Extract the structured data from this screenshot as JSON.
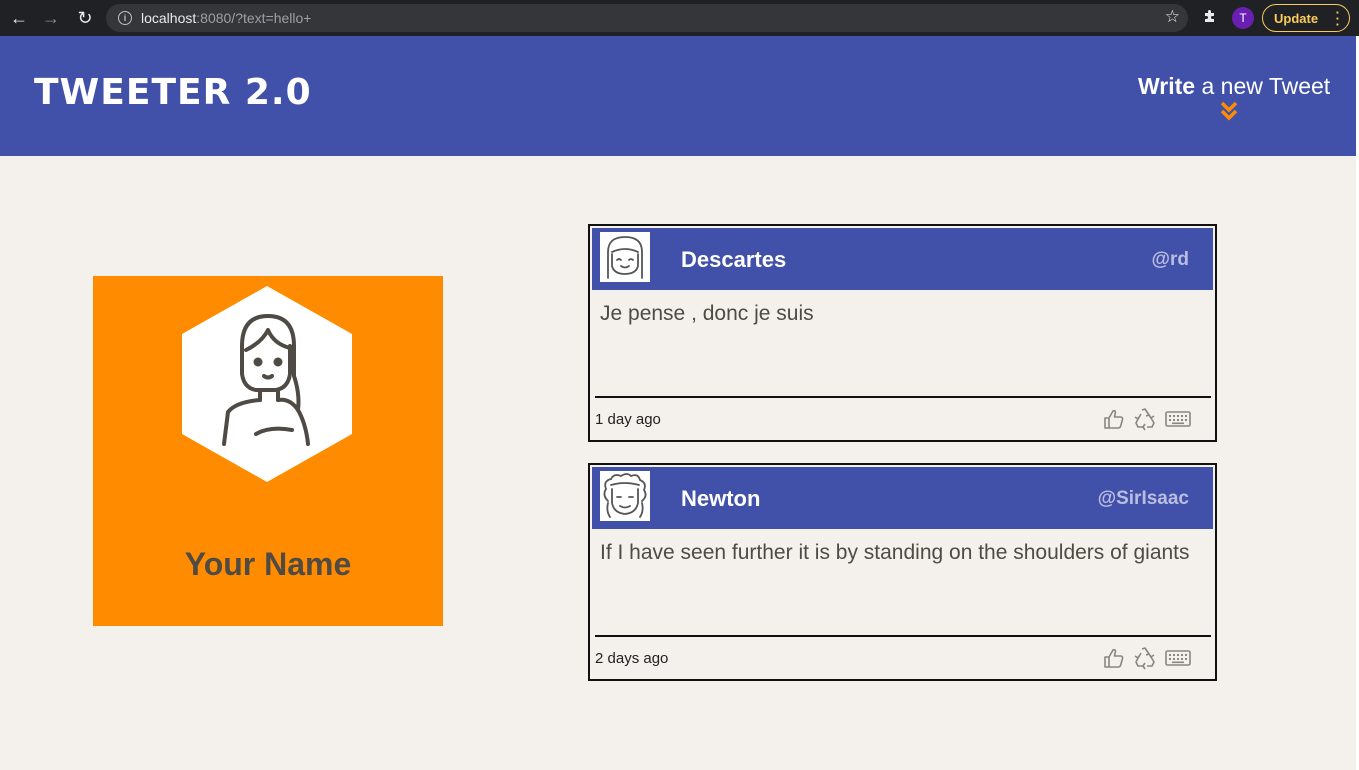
{
  "browser": {
    "url_host": "localhost",
    "url_rest": ":8080/?text=hello+",
    "profile_initial": "T",
    "update_label": "Update"
  },
  "header": {
    "brand": "TWEETER 2.0",
    "write_bold": "Write",
    "write_rest": " a new Tweet",
    "accent_color": "#ff8c00",
    "bg_color": "#4150a9"
  },
  "profile": {
    "name": "Your Name",
    "card_color": "#ff8c00",
    "avatar_icon": "girl-avatar-icon"
  },
  "tweets": [
    {
      "name": "Descartes",
      "handle": "@rd",
      "text": "Je pense , donc je suis",
      "time": "1 day ago",
      "avatar_icon": "descartes-avatar-icon"
    },
    {
      "name": "Newton",
      "handle": "@SirIsaac",
      "text": "If I have seen further it is by standing on the shoulders of giants",
      "time": "2 days ago",
      "avatar_icon": "newton-avatar-icon"
    }
  ],
  "tweet_actions": [
    "like-icon",
    "retweet-icon",
    "keyboard-icon"
  ]
}
